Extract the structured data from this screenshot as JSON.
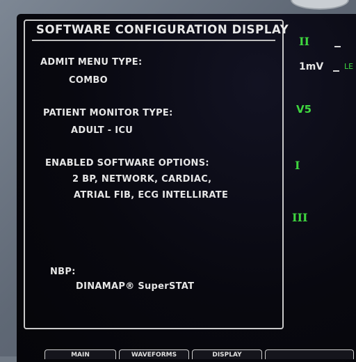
{
  "dialog": {
    "title": "SOFTWARE CONFIGURATION DISPLAY",
    "admit_menu_type": {
      "label": "ADMIT MENU TYPE:",
      "value": "COMBO"
    },
    "patient_monitor_type": {
      "label": "PATIENT MONITOR TYPE:",
      "value": "ADULT - ICU"
    },
    "enabled_software_options": {
      "label": "ENABLED SOFTWARE OPTIONS:",
      "line1": "2 BP, NETWORK, CARDIAC,",
      "line2": "ATRIAL FIB, ECG INTELLIRATE"
    },
    "nbp": {
      "label": "NBP:",
      "value": "DINAMAP® SuperSTAT"
    }
  },
  "waveforms": {
    "leads": [
      "II",
      "V5",
      "I",
      "III"
    ],
    "scale_label": "1mV",
    "partial_label": "LE",
    "lead_color": "#3fd63f"
  },
  "softkeys": [
    "MAIN",
    "WAVEFORMS",
    "DISPLAY",
    ""
  ]
}
